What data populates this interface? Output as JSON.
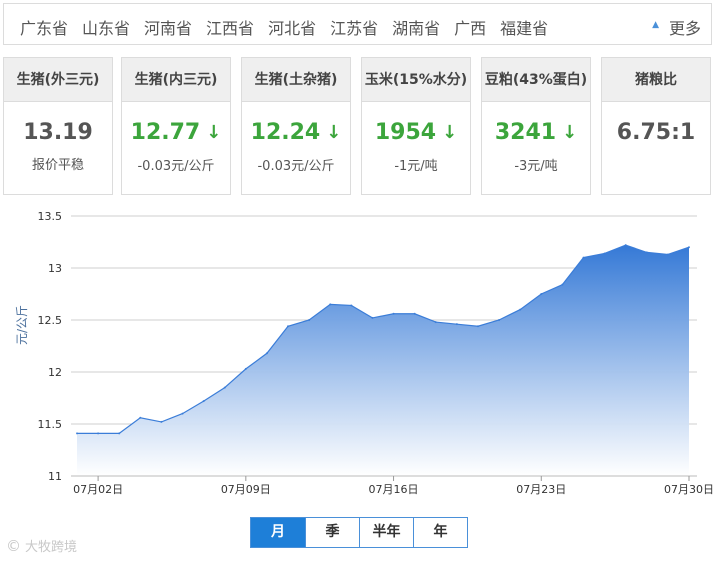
{
  "provinces": [
    "广东省",
    "山东省",
    "河南省",
    "江西省",
    "河北省",
    "江苏省",
    "湖南省",
    "广西",
    "福建省"
  ],
  "more_label": "更多",
  "cards": [
    {
      "title": "生猪(外三元)",
      "value": "13.19",
      "arrow": "",
      "sub": "报价平稳",
      "trend": "flat"
    },
    {
      "title": "生猪(内三元)",
      "value": "12.77",
      "arrow": "↓",
      "sub": "-0.03元/公斤",
      "trend": "down"
    },
    {
      "title": "生猪(土杂猪)",
      "value": "12.24",
      "arrow": "↓",
      "sub": "-0.03元/公斤",
      "trend": "down"
    },
    {
      "title": "玉米(15%水分)",
      "value": "1954",
      "arrow": "↓",
      "sub": "-1元/吨",
      "trend": "down"
    },
    {
      "title": "豆粕(43%蛋白)",
      "value": "3241",
      "arrow": "↓",
      "sub": "-3元/吨",
      "trend": "down"
    },
    {
      "title": "猪粮比",
      "value": "6.75:1",
      "arrow": "",
      "sub": "",
      "trend": "flat"
    }
  ],
  "range_buttons": [
    "月",
    "季",
    "半年",
    "年"
  ],
  "range_selected": "月",
  "watermark": "大牧跨境",
  "colors": {
    "accent": "#1e7fd8",
    "down": "#3ca53c",
    "line": "#3b7dd8"
  },
  "chart_data": {
    "type": "area",
    "title": "",
    "xlabel": "",
    "ylabel": "元/公斤",
    "ylim": [
      11,
      13.5
    ],
    "yticks": [
      11,
      11.5,
      12,
      12.5,
      13,
      13.5
    ],
    "ytick_labels": [
      "11",
      "11.5",
      "12",
      "12.5",
      "13",
      "13.5"
    ],
    "xlim": [
      "2018-07-01",
      "2018-07-30"
    ],
    "xticks": [
      "07月02日",
      "07月09日",
      "07月16日",
      "07月23日",
      "07月30日"
    ],
    "grid": true,
    "series": [
      {
        "x": [
          "07-01",
          "07-02",
          "07-03",
          "07-04",
          "07-05",
          "07-06",
          "07-07",
          "07-08",
          "07-09",
          "07-10",
          "07-11",
          "07-12",
          "07-13",
          "07-14",
          "07-15",
          "07-16",
          "07-17",
          "07-18",
          "07-19",
          "07-20",
          "07-21",
          "07-22",
          "07-23",
          "07-24",
          "07-25",
          "07-26",
          "07-27",
          "07-28",
          "07-29",
          "07-30"
        ],
        "values": [
          11.41,
          11.41,
          11.41,
          11.56,
          11.52,
          11.6,
          11.72,
          11.85,
          12.03,
          12.18,
          12.44,
          12.5,
          12.65,
          12.64,
          12.52,
          12.56,
          12.56,
          12.48,
          12.46,
          12.44,
          12.5,
          12.6,
          12.75,
          12.84,
          13.1,
          13.14,
          13.22,
          13.15,
          13.13,
          13.2
        ]
      }
    ]
  }
}
